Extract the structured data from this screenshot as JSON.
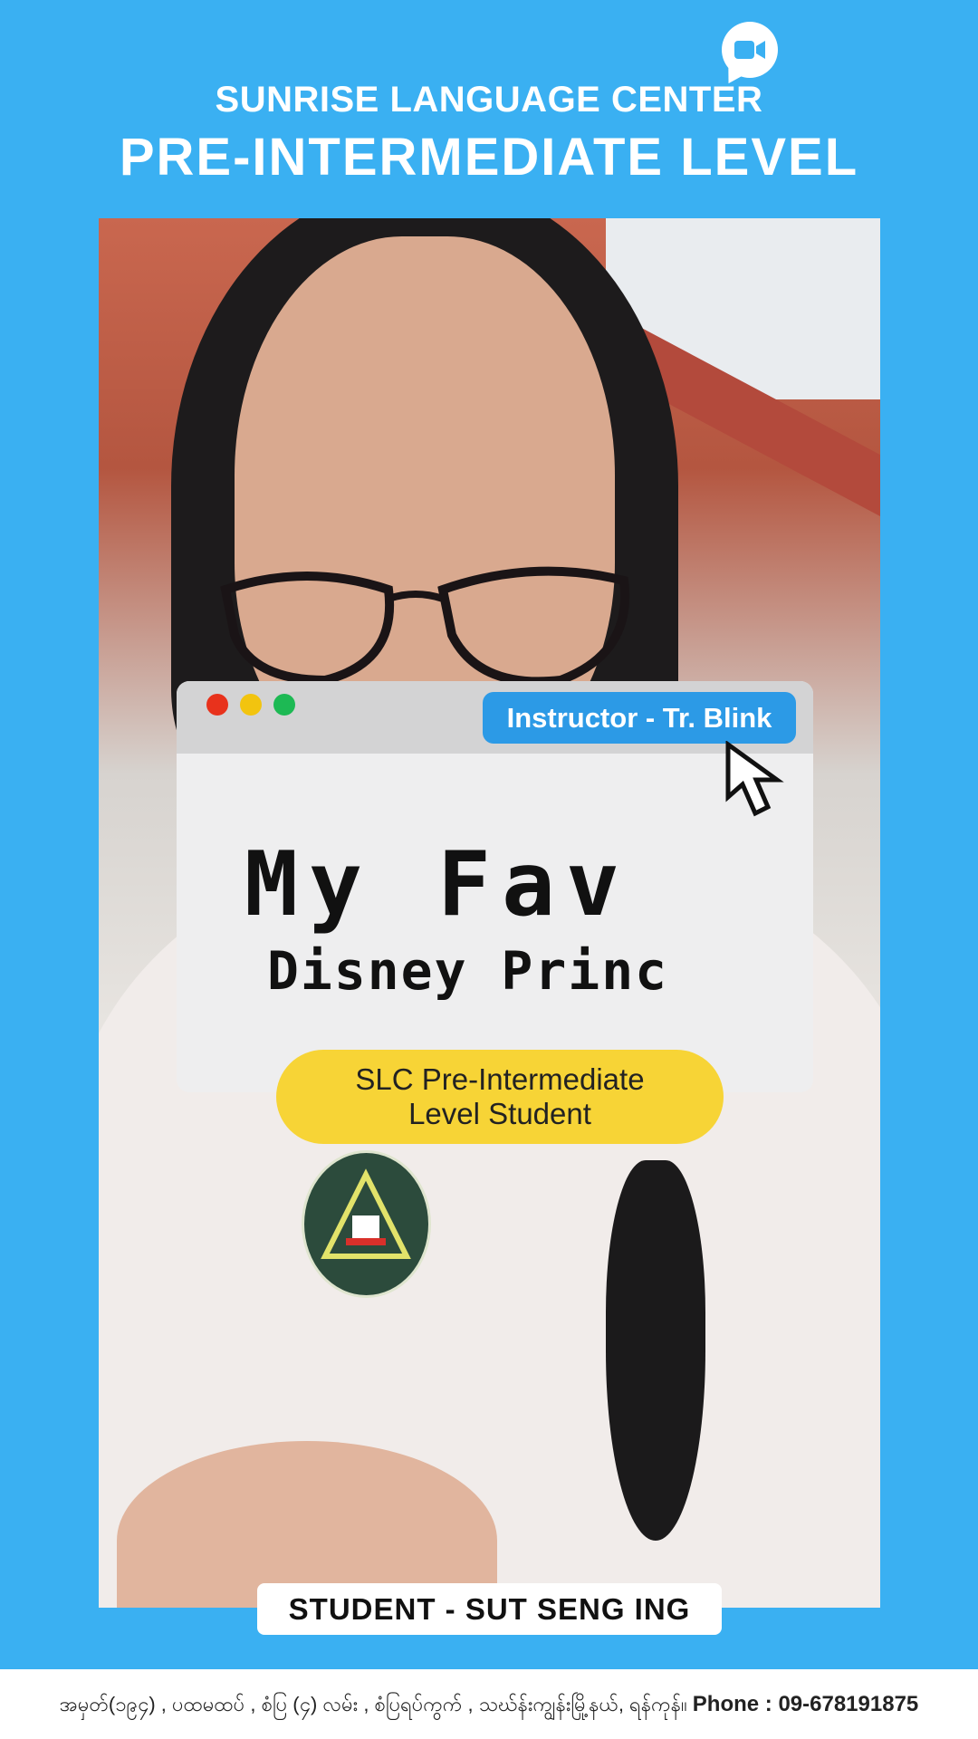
{
  "header": {
    "brand": "SUNRISE LANGUAGE CENTER",
    "level": "PRE-INTERMEDIATE LEVEL",
    "badge_icon": "video-camera-icon"
  },
  "window": {
    "instructor": "Instructor - Tr. Blink",
    "title_line1": "My Fav",
    "title_line2": "Disney Princ",
    "dot_colors": [
      "#e8321c",
      "#f2c40f",
      "#1db954"
    ]
  },
  "pill": {
    "line1": "SLC Pre-Intermediate",
    "line2": "Level Student"
  },
  "student_label": "STUDENT - SUT SENG ING",
  "footer": {
    "address": "အမှတ်(၁၉၄) , ပထမထပ် , စံပြ (၄) လမ်း , စံပြရပ်ကွက် , သဃ်န်းကျွန်းမြို့နယ်, ရန်ကုန်။",
    "phone": "Phone : 09-678191875"
  },
  "colors": {
    "background": "#3ab0f2",
    "instructor_badge": "#2c9ae6",
    "pill": "#f7d436"
  }
}
